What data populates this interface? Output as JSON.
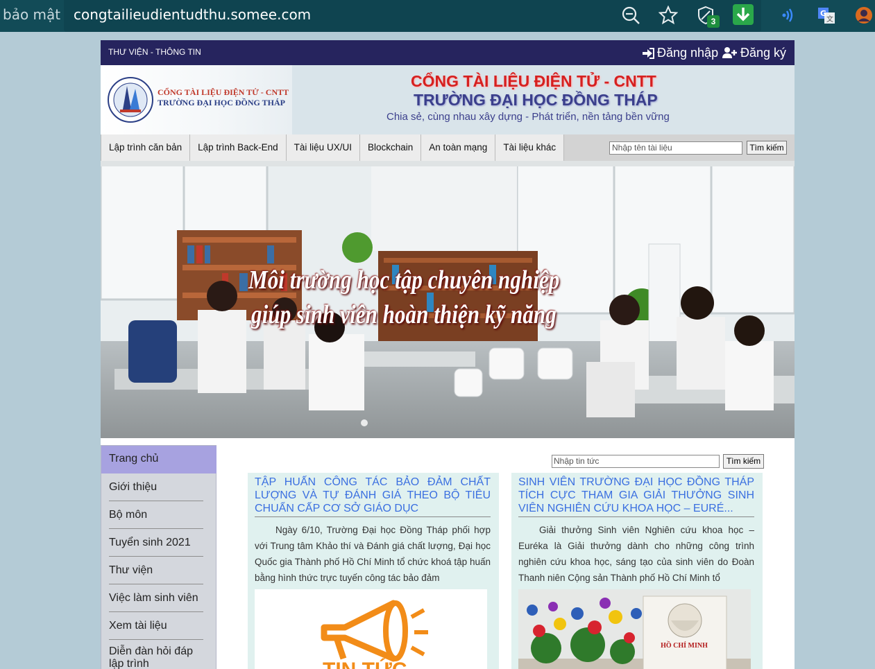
{
  "browser": {
    "security_label": "bảo mật",
    "url": "congtailieudientudthu.somee.com",
    "extension_badge": "3"
  },
  "topbar": {
    "title": "THƯ VIỆN - THÔNG TIN",
    "login_label": "Đăng nhập",
    "register_label": "Đăng ký"
  },
  "header": {
    "logo_line1": "CỔNG TÀI LIỆU ĐIỆN TỬ - CNTT",
    "logo_line2": "TRƯỜNG ĐẠI HỌC ĐỒNG THÁP",
    "title_line1": "CỔNG TÀI LIỆU ĐIỆN TỬ - CNTT",
    "title_line2": "TRƯỜNG ĐẠI HỌC ĐỒNG THÁP",
    "slogan": "Chia sẻ, cùng nhau xây dựng - Phát triển, nền tảng bền vững"
  },
  "nav": {
    "items": [
      "Lập trình căn bản",
      "Lập trình Back-End",
      "Tài liệu UX/UI",
      "Blockchain",
      "An toàn mạng",
      "Tài liệu khác"
    ],
    "search_placeholder": "Nhập tên tài liệu",
    "search_button": "Tìm kiếm"
  },
  "banner": {
    "line1": "Môi trường học tập chuyên nghiệp",
    "line2": "giúp sinh viên hoàn thiện kỹ năng"
  },
  "sidebar": {
    "items": [
      "Trang chủ",
      "Giới thiệu",
      "Bộ môn",
      "Tuyển sinh 2021",
      "Thư viện",
      "Việc làm sinh viên",
      "Xem tài liệu",
      "Diễn đàn hỏi đáp lập trình"
    ]
  },
  "news": {
    "search_placeholder": "Nhập tin tức",
    "search_button": "Tìm kiếm",
    "articles": [
      {
        "title": "TẬP HUẤN CÔNG TÁC BẢO ĐẢM CHẤT LƯỢNG VÀ TỰ ĐÁNH GIÁ THEO BỘ TIÊU CHUẨN CẤP CƠ SỞ GIÁO DỤC",
        "body": "Ngày 6/10, Trường Đại học Đồng Tháp phối hợp với Trung tâm Khảo thí và Đánh giá chất lượng, Đại học Quốc gia Thành phố Hồ Chí Minh tổ chức khoá tập huấn bằng hình thức trực tuyến công tác bảo đảm",
        "image_label": "TIN TỨC"
      },
      {
        "title": "SINH VIÊN TRƯỜNG ĐẠI HỌC ĐỒNG THÁP TÍCH CỰC THAM GIA GIẢI THƯỞNG SINH VIÊN NGHIÊN CỨU KHOA HỌC – EURÉ...",
        "body": "Giải thưởng Sinh viên Nghiên cứu khoa học – Euréka là Giải thưởng dành cho những công trình nghiên cứu khoa học, sáng tạo của sinh viên do Đoàn Thanh niên Cộng sản Thành phố Hồ Chí Minh tổ",
        "book_title": "HỒ CHÍ MINH"
      }
    ]
  }
}
